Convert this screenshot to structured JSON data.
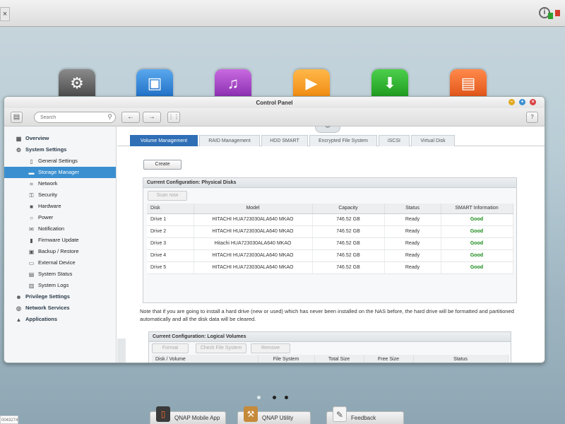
{
  "window": {
    "title": "Control Panel"
  },
  "toolbar": {
    "search_placeholder": "Search",
    "back_glyph": "←",
    "forward_glyph": "→",
    "help_label": "?"
  },
  "sidebar": {
    "items": [
      {
        "label": "Overview",
        "level": 1,
        "icon": "grid-icon"
      },
      {
        "label": "System Settings",
        "level": 1,
        "icon": "gear-icon"
      },
      {
        "label": "General Settings",
        "level": 2,
        "icon": "document-icon"
      },
      {
        "label": "Storage Manager",
        "level": 2,
        "icon": "storage-icon",
        "selected": true
      },
      {
        "label": "Network",
        "level": 2,
        "icon": "network-icon"
      },
      {
        "label": "Security",
        "level": 2,
        "icon": "lock-icon"
      },
      {
        "label": "Hardware",
        "level": 2,
        "icon": "hardware-icon"
      },
      {
        "label": "Power",
        "level": 2,
        "icon": "bulb-icon"
      },
      {
        "label": "Notification",
        "level": 2,
        "icon": "mail-icon"
      },
      {
        "label": "Firmware Update",
        "level": 2,
        "icon": "firmware-icon"
      },
      {
        "label": "Backup / Restore",
        "level": 2,
        "icon": "backup-icon"
      },
      {
        "label": "External Device",
        "level": 2,
        "icon": "external-device-icon"
      },
      {
        "label": "System Status",
        "level": 2,
        "icon": "status-icon"
      },
      {
        "label": "System Logs",
        "level": 2,
        "icon": "logs-icon"
      },
      {
        "label": "Privilege Settings",
        "level": 1,
        "icon": "user-icon"
      },
      {
        "label": "Network Services",
        "level": 1,
        "icon": "globe-icon"
      },
      {
        "label": "Applications",
        "level": 1,
        "icon": "applications-icon"
      }
    ]
  },
  "tabs": [
    {
      "label": "Volume Management",
      "active": true
    },
    {
      "label": "RAID Management"
    },
    {
      "label": "HDD SMART"
    },
    {
      "label": "Encrypted File System"
    },
    {
      "label": "iSCSI"
    },
    {
      "label": "Virtual Disk"
    }
  ],
  "buttons": {
    "create": "Create",
    "scan_now": "Scan now",
    "format": "Format",
    "check_file_system": "Check File System",
    "remove": "Remove"
  },
  "physical_disks": {
    "title": "Current Configuration: Physical Disks",
    "columns": [
      "Disk",
      "Model",
      "Capacity",
      "Status",
      "SMART Information"
    ],
    "rows": [
      [
        "Drive 1",
        "HITACHI HUA723030ALA640 MKAO",
        "746.52 GB",
        "Ready",
        "Good"
      ],
      [
        "Drive 2",
        "HITACHI HUA723030ALA640 MKAO",
        "746.52 GB",
        "Ready",
        "Good"
      ],
      [
        "Drive 3",
        "Hitachi HUA723030ALA640 MKAO",
        "746.52 GB",
        "Ready",
        "Good"
      ],
      [
        "Drive 4",
        "HITACHI HUA723030ALA640 MKAO",
        "746.52 GB",
        "Ready",
        "Good"
      ],
      [
        "Drive 5",
        "HITACHI HUA723030ALA640 MKAO",
        "746.52 GB",
        "Ready",
        "Good"
      ]
    ]
  },
  "note": "Note that if you are going to install a hard drive (new or used) which has never been installed on the NAS before, the hard drive will be formatted and partitioned automatically and all the disk data will be cleared.",
  "logical_volumes": {
    "title": "Current Configuration: Logical Volumes",
    "columns": [
      "Disk / Volume",
      "File System",
      "Total Size",
      "Free Size",
      "Status"
    ]
  },
  "dock": [
    {
      "label": "QNAP Mobile App",
      "icon": "mobile-app-icon"
    },
    {
      "label": "QNAP Utility",
      "icon": "utility-icon"
    },
    {
      "label": "Feedback",
      "icon": "feedback-icon"
    }
  ],
  "desktop_icons": [
    "control-panel-icon",
    "photo-station-icon",
    "music-station-icon",
    "video-station-icon",
    "download-station-icon",
    "file-station-icon"
  ],
  "bottom_left_text": "0043274",
  "colors": {
    "accent": "#3a8fd0",
    "active_tab": "#2e6fb6",
    "good": "#1a8a1a"
  }
}
